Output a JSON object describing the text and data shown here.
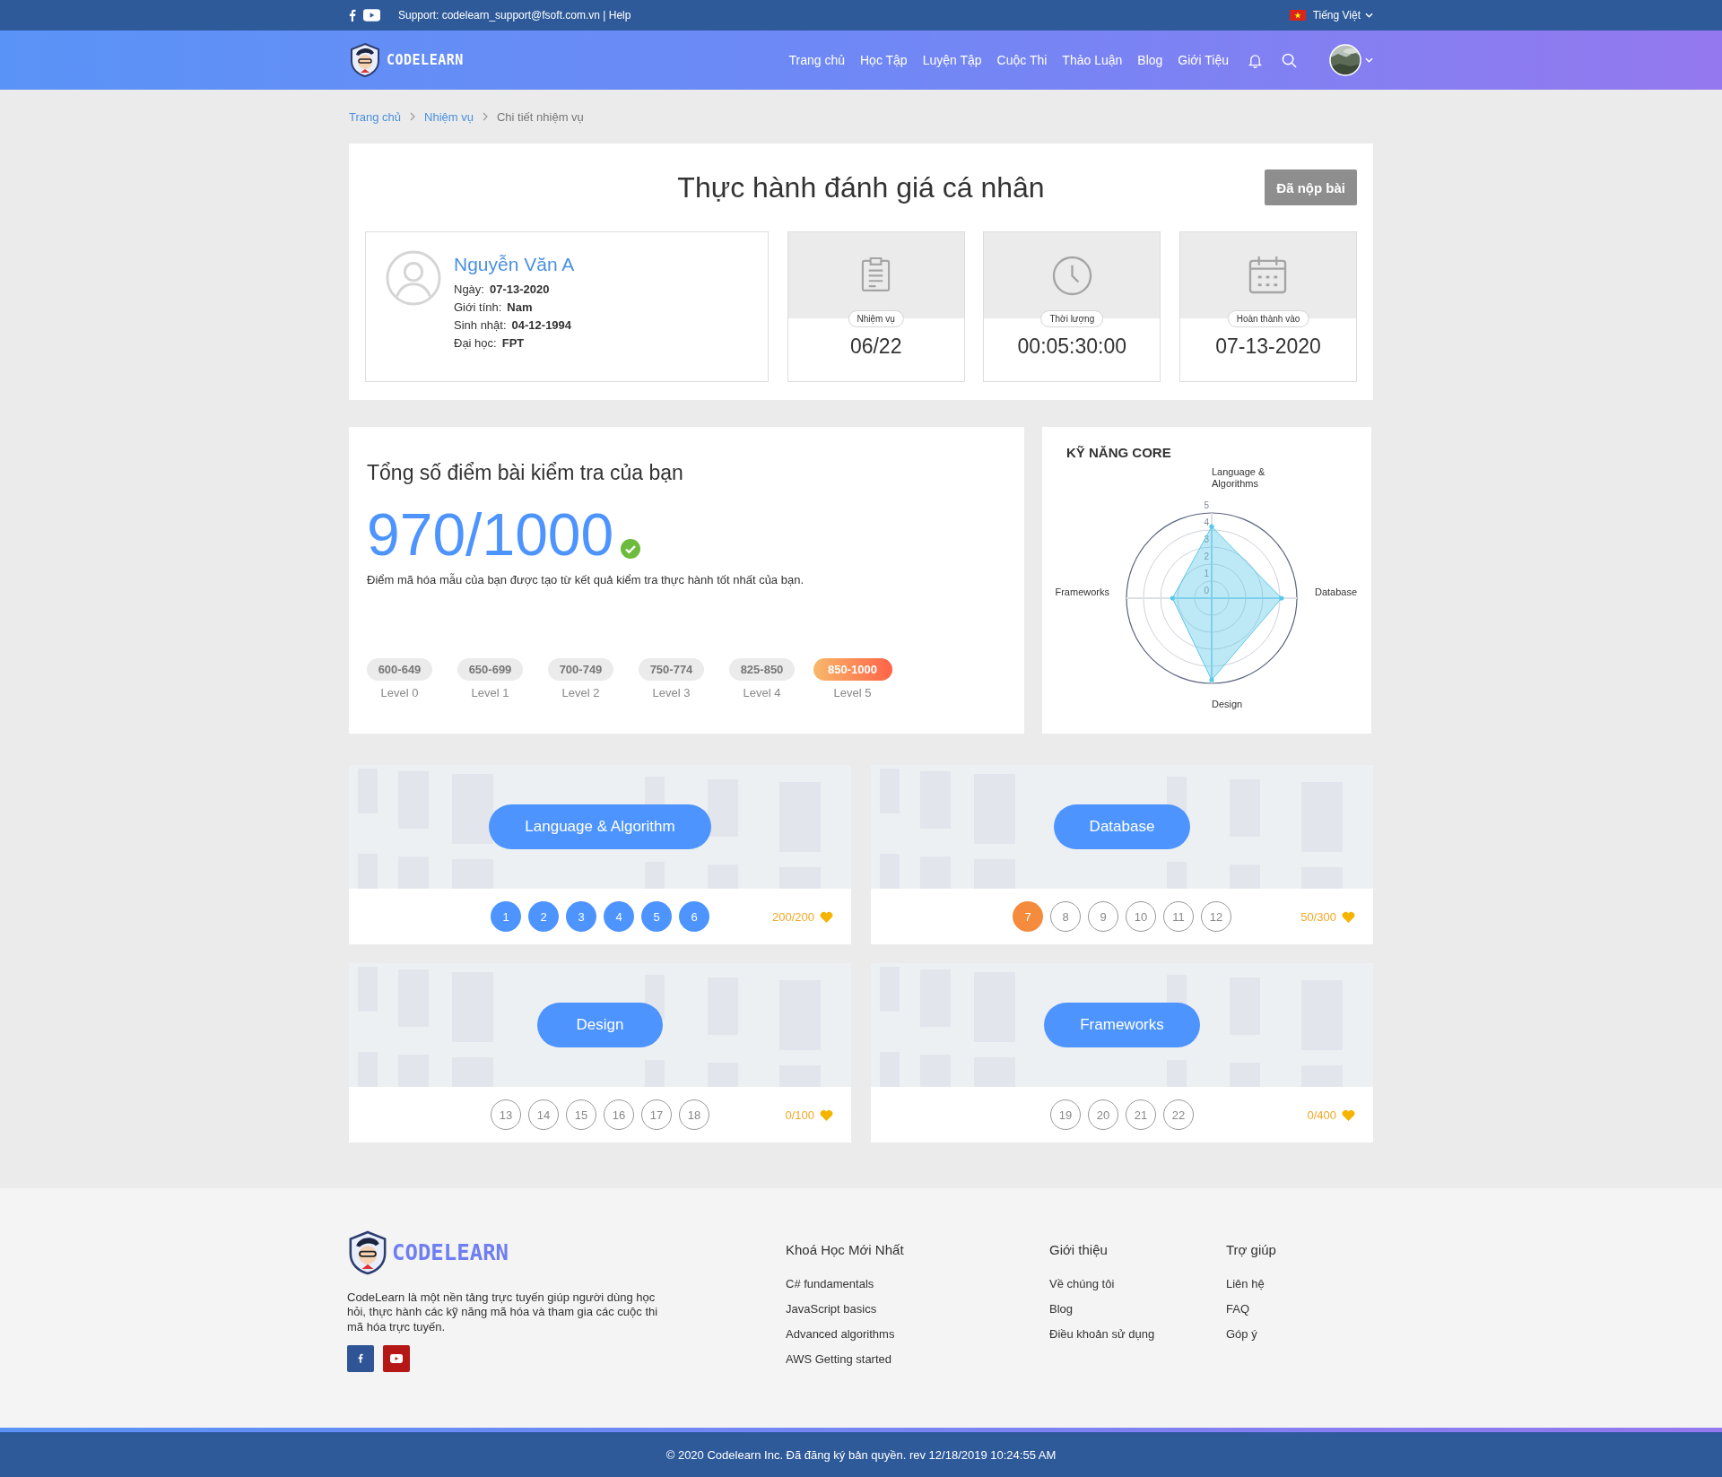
{
  "top_bar": {
    "support": "Support: codelearn_support@fsoft.com.vn | Help",
    "language": "Tiếng Việt"
  },
  "nav": {
    "logo": "CODELEARN",
    "items": [
      "Trang chủ",
      "Học Tập",
      "Luyện Tập",
      "Cuộc Thi",
      "Thảo Luận",
      "Blog",
      "Giới Tiệu"
    ]
  },
  "breadcrumb": [
    {
      "label": "Trang chủ",
      "kind": "link"
    },
    {
      "label": "Nhiệm vụ",
      "kind": "link"
    },
    {
      "label": "Chi tiết nhiệm vụ",
      "kind": "current"
    }
  ],
  "header": {
    "title": "Thực hành đánh giá cá nhân",
    "submit_button": {
      "label": "Đã nộp bài",
      "disabled": true
    }
  },
  "profile": {
    "name": "Nguyễn Văn A",
    "fields": [
      {
        "label": "Ngày:",
        "value": "07-13-2020"
      },
      {
        "label": "Giới tính:",
        "value": "Nam"
      },
      {
        "label": "Sinh nhật:",
        "value": "04-12-1994"
      },
      {
        "label": "Đại học:",
        "value": "FPT"
      }
    ]
  },
  "stats": [
    {
      "kind": "task",
      "label": "Nhiệm vụ",
      "value": "06/22"
    },
    {
      "kind": "time",
      "label": "Thời lượng",
      "value": "00:05:30:00"
    },
    {
      "kind": "calendar",
      "label": "Hoàn thành vào",
      "value": "07-13-2020"
    }
  ],
  "score": {
    "title": "Tổng số điểm bài kiểm tra của bạn",
    "value": "970/1000",
    "passed": true,
    "note": "Điểm mã hóa mẫu của bạn được tạo từ kết quả kiểm tra thực hành tốt nhất của bạn.",
    "levels": [
      {
        "range": "600-649",
        "label": "Level 0",
        "selected": false
      },
      {
        "range": "650-699",
        "label": "Level 1",
        "selected": false
      },
      {
        "range": "700-749",
        "label": "Level 2",
        "selected": false
      },
      {
        "range": "750-774",
        "label": "Level 3",
        "selected": false
      },
      {
        "range": "825-850",
        "label": "Level 4",
        "selected": false
      },
      {
        "range": "850-1000",
        "label": "Level 5",
        "selected": true
      }
    ]
  },
  "skills": {
    "title": "KỸ NĂNG CORE",
    "ticks": [
      "5",
      "4",
      "3",
      "2",
      "1",
      "0"
    ],
    "axes": [
      {
        "label": "Language & Algorithms",
        "level": 0.84
      },
      {
        "label": "Database",
        "level": 0.82
      },
      {
        "label": "Design",
        "level": 0.96
      },
      {
        "label": "Frameworks",
        "level": 0.46
      }
    ]
  },
  "skill_groups": [
    {
      "title": "Language & Algorithm",
      "points": "200/200",
      "tasks": [
        {
          "number": "1",
          "kind": "done"
        },
        {
          "number": "2",
          "kind": "done"
        },
        {
          "number": "3",
          "kind": "done"
        },
        {
          "number": "4",
          "kind": "done"
        },
        {
          "number": "5",
          "kind": "done"
        },
        {
          "number": "6",
          "kind": "done"
        }
      ]
    },
    {
      "title": "Database",
      "points": "50/300",
      "tasks": [
        {
          "number": "7",
          "kind": "current"
        },
        {
          "number": "8",
          "kind": "open"
        },
        {
          "number": "9",
          "kind": "open"
        },
        {
          "number": "10",
          "kind": "open"
        },
        {
          "number": "11",
          "kind": "open"
        },
        {
          "number": "12",
          "kind": "open"
        }
      ]
    },
    {
      "title": "Design",
      "points": "0/100",
      "tasks": [
        {
          "number": "13",
          "kind": "open"
        },
        {
          "number": "14",
          "kind": "open"
        },
        {
          "number": "15",
          "kind": "open"
        },
        {
          "number": "16",
          "kind": "open"
        },
        {
          "number": "17",
          "kind": "open"
        },
        {
          "number": "18",
          "kind": "open"
        }
      ]
    },
    {
      "title": "Frameworks",
      "points": "0/400",
      "tasks": [
        {
          "number": "19",
          "kind": "open"
        },
        {
          "number": "20",
          "kind": "open"
        },
        {
          "number": "21",
          "kind": "open"
        },
        {
          "number": "22",
          "kind": "open"
        }
      ]
    }
  ],
  "footer": {
    "logo": "CODELEARN",
    "description": "CodeLearn là một nền tảng trực tuyến giúp người dùng học hỏi, thực hành các kỹ năng mã hóa và tham gia các cuộc thi mã hóa trực tuyến.",
    "columns": [
      {
        "title": "Khoá Học Mới Nhất",
        "links": [
          "C# fundamentals",
          "JavaScript basics",
          "Advanced algorithms",
          "AWS Getting started"
        ]
      },
      {
        "title": "Giới thiệu",
        "links": [
          "Về chúng tôi",
          "Blog",
          "Điều khoản sử dụng"
        ]
      },
      {
        "title": "Trợ giúp",
        "links": [
          "Liên hệ",
          "FAQ",
          "Góp ý"
        ]
      }
    ],
    "copyright": "© 2020 Codelearn Inc. Đã đăng ký bản quyền. rev 12/18/2019 10:24:55 AM"
  }
}
